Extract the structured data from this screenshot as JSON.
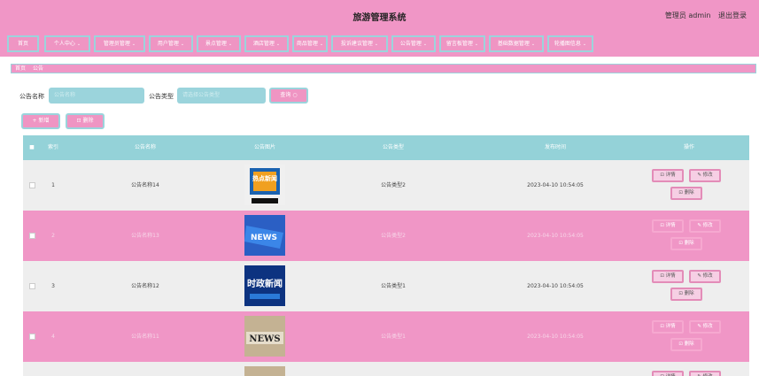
{
  "header": {
    "title": "旅游管理系统",
    "user": "管理员 admin",
    "logout": "退出登录"
  },
  "nav": [
    {
      "label": "首页",
      "chev": ""
    },
    {
      "label": "个人中心",
      "chev": "⌄"
    },
    {
      "label": "管理员管理",
      "chev": "⌄"
    },
    {
      "label": "用户管理",
      "chev": "⌄"
    },
    {
      "label": "景点管理",
      "chev": "⌄"
    },
    {
      "label": "酒店管理",
      "chev": "⌄"
    },
    {
      "label": "商品管理",
      "chev": "⌄"
    },
    {
      "label": "投诉建议管理",
      "chev": "⌄"
    },
    {
      "label": "公告管理",
      "chev": "⌄"
    },
    {
      "label": "留言板管理",
      "chev": "⌄"
    },
    {
      "label": "基础数据管理",
      "chev": "⌄"
    },
    {
      "label": "轮播图信息",
      "chev": "⌄"
    }
  ],
  "breadcrumb": {
    "home": "首页",
    "current": "公告"
  },
  "search": {
    "name_label": "公告名称",
    "name_placeholder": "公告名称",
    "type_label": "公告类型",
    "type_placeholder": "请选择公告类型",
    "query_label": "查询 ○"
  },
  "actions": {
    "add": "+ 新增",
    "delete": "⊡ 删除"
  },
  "table": {
    "headers": [
      "■",
      "索引",
      "公告名称",
      "公告图片",
      "公告类型",
      "发布时间",
      "操作"
    ],
    "rows": [
      {
        "index": "1",
        "name": "公告名称14",
        "type": "公告类型2",
        "time": "2023-04-10 10:54:05",
        "img": "热点新闻"
      },
      {
        "index": "2",
        "name": "公告名称13",
        "type": "公告类型2",
        "time": "2023-04-10 10:54:05",
        "img": "NEWS"
      },
      {
        "index": "3",
        "name": "公告名称12",
        "type": "公告类型1",
        "time": "2023-04-10 10:54:05",
        "img": "时政新闻"
      },
      {
        "index": "4",
        "name": "公告名称11",
        "type": "公告类型1",
        "time": "2023-04-10 10:54:05",
        "img": "NEWS"
      }
    ],
    "row_actions": {
      "detail": "⊡ 详情",
      "edit": "✎ 修改",
      "delete": "⊡ 删除"
    }
  }
}
